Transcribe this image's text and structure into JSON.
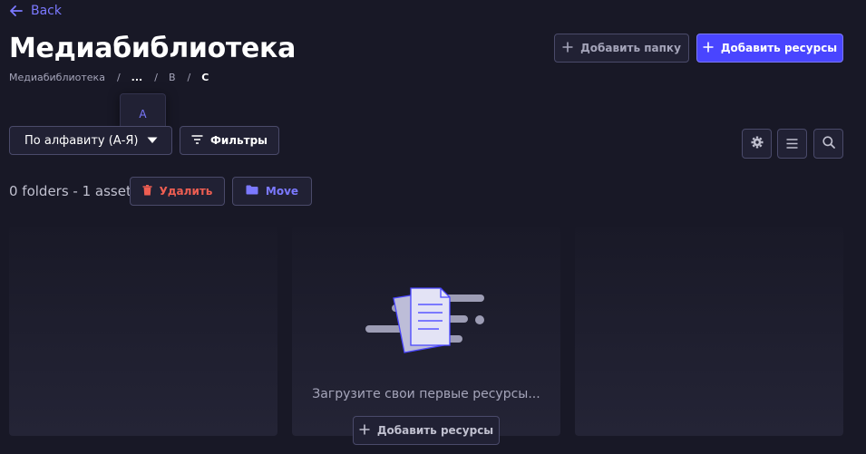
{
  "back": {
    "label": "Back"
  },
  "header": {
    "title": "Медиабиблиотека",
    "add_folder_label": "Добавить папку",
    "add_assets_label": "Добавить ресурсы"
  },
  "breadcrumb": {
    "root": "Медиабиблиотека",
    "ellipsis": "...",
    "middle": "B",
    "current": "C",
    "separator": "/",
    "dropdown_items": [
      "A"
    ]
  },
  "toolbar": {
    "sort_value": "По алфавиту (А-Я)",
    "filters_label": "Фильтры"
  },
  "selection": {
    "count_text": "0 folders - 1 asset",
    "delete_label": "Удалить",
    "move_label": "Move"
  },
  "empty_state": {
    "message": "Загрузите свои первые ресурсы...",
    "add_assets_label": "Добавить ресурсы"
  },
  "icons": {
    "back": "arrow-left-icon",
    "plus": "plus-icon",
    "chevron": "chevron-down-icon",
    "filter": "filter-icon",
    "settings": "gear-icon",
    "list": "list-icon",
    "search": "search-icon",
    "trash": "trash-icon",
    "folder": "folder-icon",
    "illustration": "documents-illustration"
  },
  "colors": {
    "background": "#181826",
    "surface": "#212134",
    "border": "#4a4a6a",
    "primary": "#4945ff",
    "primary_text": "#7b79ff",
    "danger": "#ee5e52"
  }
}
